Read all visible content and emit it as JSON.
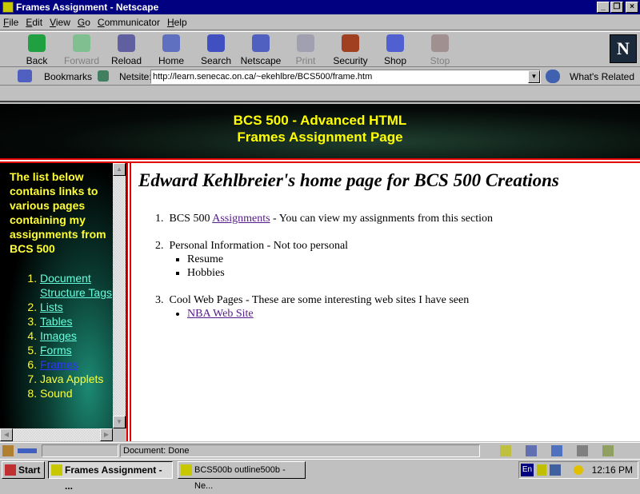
{
  "window": {
    "title": "Frames Assignment - Netscape"
  },
  "menu": [
    "File",
    "Edit",
    "View",
    "Go",
    "Communicator",
    "Help"
  ],
  "toolbar": [
    {
      "label": "Back",
      "icon": "back-arrow-icon",
      "color": "#20a040",
      "enabled": true
    },
    {
      "label": "Forward",
      "icon": "forward-arrow-icon",
      "color": "#80c090",
      "enabled": false
    },
    {
      "label": "Reload",
      "icon": "reload-icon",
      "color": "#6060a0",
      "enabled": true
    },
    {
      "label": "Home",
      "icon": "home-icon",
      "color": "#6070c0",
      "enabled": true
    },
    {
      "label": "Search",
      "icon": "search-icon",
      "color": "#4050c0",
      "enabled": true
    },
    {
      "label": "Netscape",
      "icon": "my-netscape-icon",
      "color": "#5060c0",
      "enabled": true
    },
    {
      "label": "Print",
      "icon": "print-icon",
      "color": "#a0a0b0",
      "enabled": false
    },
    {
      "label": "Security",
      "icon": "lock-icon",
      "color": "#a04020",
      "enabled": true
    },
    {
      "label": "Shop",
      "icon": "shopping-bag-icon",
      "color": "#5060d0",
      "enabled": true
    },
    {
      "label": "Stop",
      "icon": "stop-icon",
      "color": "#a09090",
      "enabled": false
    }
  ],
  "location": {
    "bookmarks_label": "Bookmarks",
    "netsite_label": "Netsite:",
    "url": "http://learn.senecac.on.ca/~ekehlbre/BCS500/frame.htm",
    "whats_related": "What's Related"
  },
  "banner": {
    "line1": "BCS 500 - Advanced HTML",
    "line2": "Frames Assignment Page"
  },
  "left_frame": {
    "intro": "The list below contains links to various pages containing my assignments from BCS 500",
    "items": [
      {
        "label": "Document Structure Tags",
        "link": true
      },
      {
        "label": "Lists",
        "link": true
      },
      {
        "label": "Tables",
        "link": true
      },
      {
        "label": "Images",
        "link": true
      },
      {
        "label": "Forms",
        "link": true
      },
      {
        "label": "Frames",
        "link": true,
        "active": true
      },
      {
        "label": "Java Applets",
        "link": false
      },
      {
        "label": "Sound",
        "link": false
      }
    ]
  },
  "main_frame": {
    "heading": "Edward Kehlbreier's home page for BCS 500 Creations",
    "item1": {
      "prefix": "BCS 500 ",
      "link": "Assignments",
      "suffix": " - You can view my assignments from this section"
    },
    "item2": {
      "text": "Personal Information - Not too personal",
      "subitems": [
        "Resume",
        "Hobbies"
      ]
    },
    "item3": {
      "text": "Cool Web Pages - These are some interesting web sites I have seen",
      "links": [
        "NBA Web Site"
      ]
    }
  },
  "status": {
    "text": "Document: Done"
  },
  "taskbar": {
    "start": "Start",
    "tasks": [
      "Frames Assignment - ...",
      "BCS500b outline500b - Ne..."
    ],
    "lang": "En",
    "clock": "12:16 PM"
  },
  "colors": {
    "titlebar": "#000080",
    "banner_text": "#ffff00",
    "frame_border": "#e00000",
    "link": "#551a8b"
  }
}
